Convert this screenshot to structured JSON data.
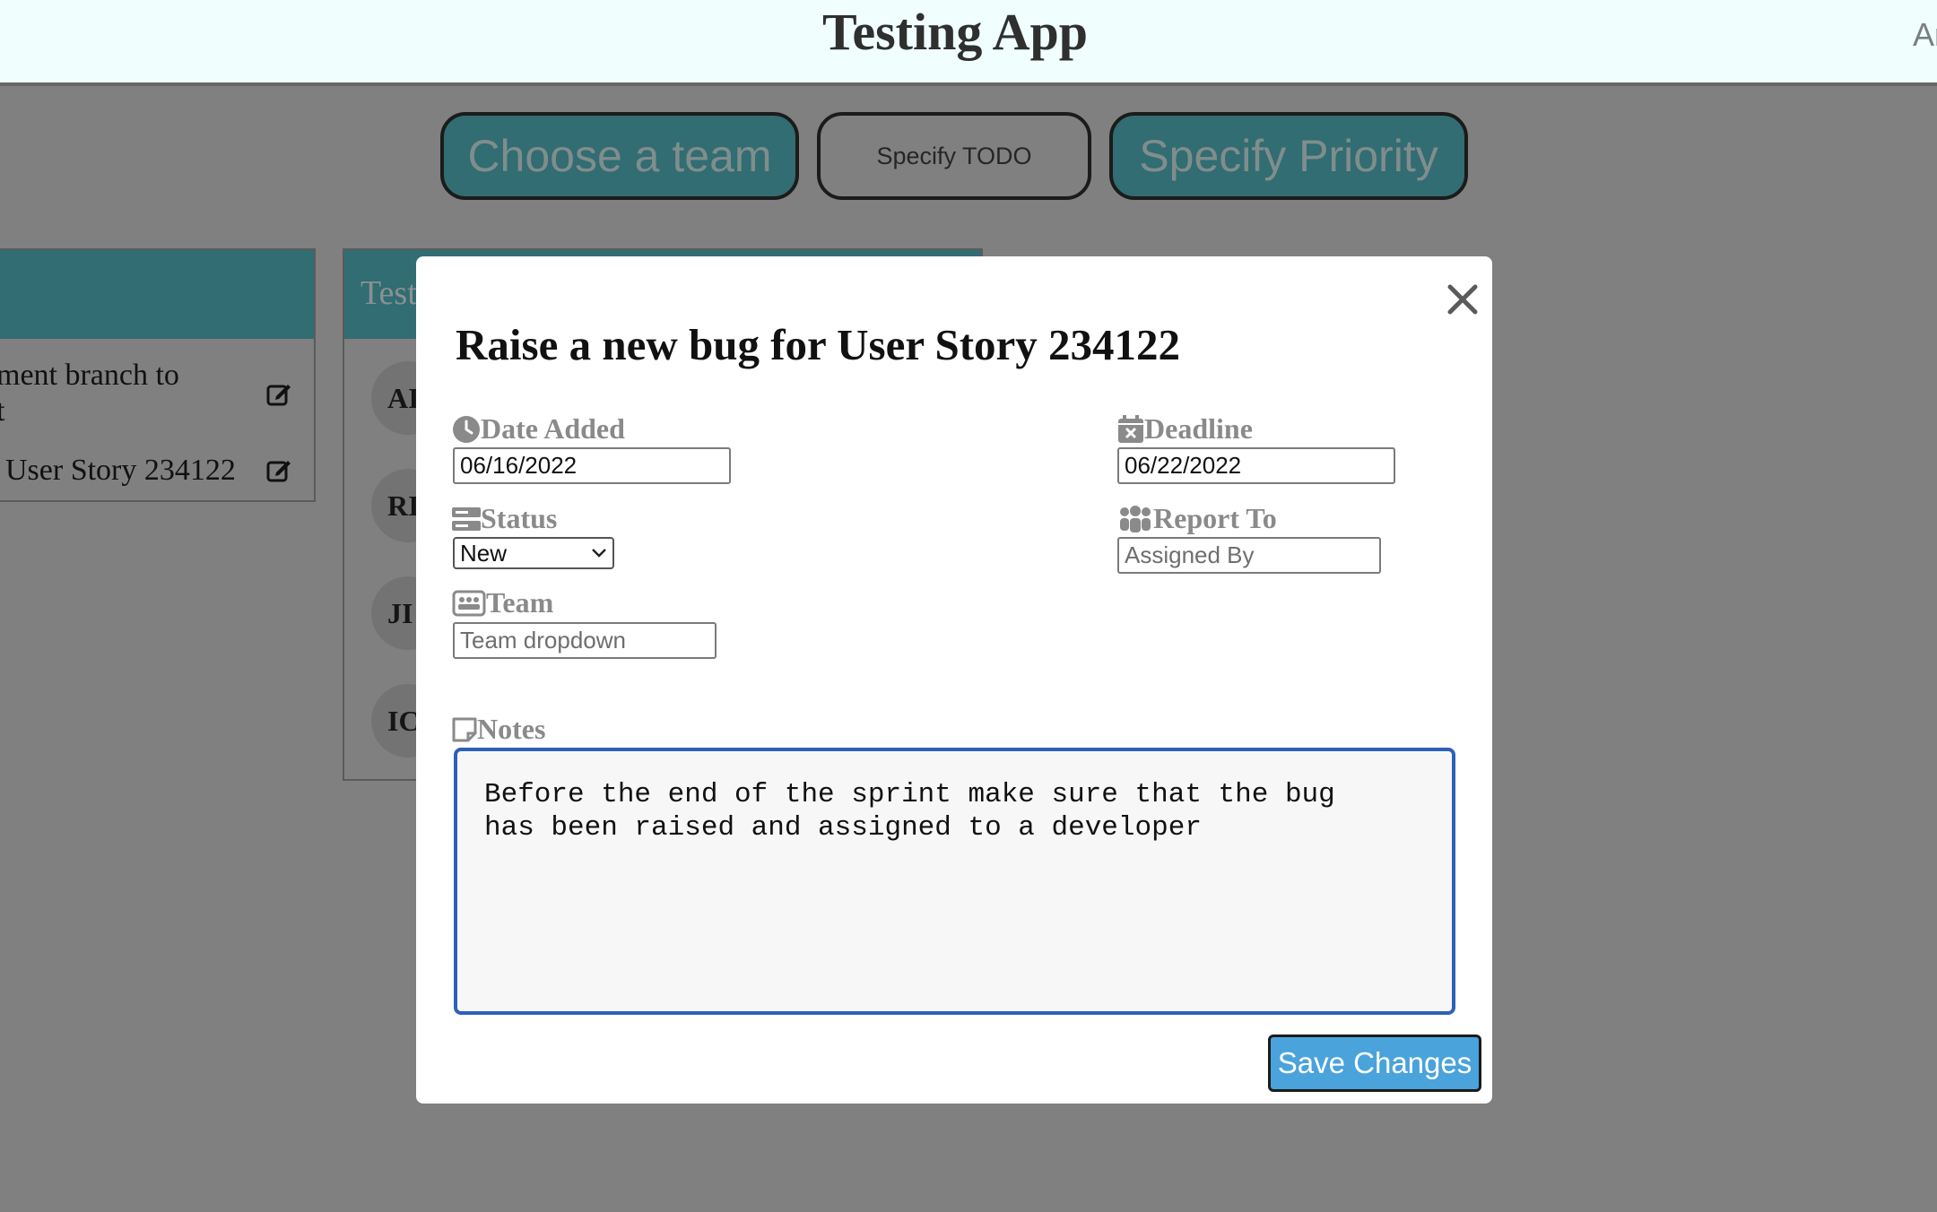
{
  "header": {
    "title": "Testing App",
    "right_text": "Ar"
  },
  "toolbar": {
    "choose_team": "Choose a team",
    "specify_todo": "Specify TODO",
    "specify_priority": "Specify Priority"
  },
  "board": {
    "column1": {
      "rows": [
        "ment branch to",
        "t",
        "User Story 234122"
      ]
    },
    "column2": {
      "title": "Test",
      "avatars": [
        "AI",
        "RI",
        "JI",
        "IC"
      ]
    }
  },
  "modal": {
    "title": "Raise a new bug for User Story 234122",
    "date_added": {
      "label": "Date Added",
      "value": "06/16/2022"
    },
    "deadline": {
      "label": "Deadline",
      "value": "06/22/2022"
    },
    "status": {
      "label": "Status",
      "selected": "New"
    },
    "report_to": {
      "label": "Report To",
      "placeholder": "Assigned By"
    },
    "team": {
      "label": "Team",
      "placeholder": "Team dropdown"
    },
    "notes": {
      "label": "Notes",
      "value": "Before the end of the sprint make sure that the bug\nhas been raised and assigned to a developer"
    },
    "save_label": "Save Changes"
  },
  "icons": {
    "date_added": "clock-icon",
    "deadline": "calendar-x-icon",
    "status": "server-icon",
    "report_to": "people-icon",
    "team": "id-badge-icon",
    "notes": "note-icon",
    "close": "close-icon",
    "edit": "edit-icon"
  },
  "colors": {
    "accent_teal": "#316d72",
    "save_button": "#4aa3db",
    "focus_border": "#2c61b8",
    "overlay": "#808080"
  }
}
